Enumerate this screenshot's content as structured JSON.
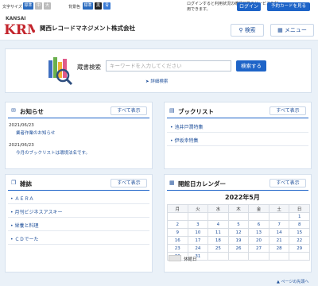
{
  "options": {
    "font_size_label": "文字サイズ",
    "font_sizes": [
      "標準",
      "中",
      "大"
    ],
    "bg_color_label": "背景色",
    "bg_colors": [
      "標準",
      "黒",
      "青"
    ]
  },
  "header": {
    "login_note": "ログインすると利用状況の確認日等のサービスを利用できます。",
    "login_label": "ログイン",
    "card_label": "予約カードを見る",
    "logo_top": "KANSAI",
    "logo_main": "KRM",
    "company": "関西レコードマネジメント株式会社",
    "search_label": "検索",
    "menu_label": "メニュー"
  },
  "search": {
    "label": "蔵書検索",
    "placeholder": "キーワードを入力してください",
    "button": "検索する",
    "advanced": "詳細検索"
  },
  "news": {
    "title": "お知らせ",
    "show_all": "すべて表示",
    "items": [
      {
        "date": "2021/06/23",
        "text": "業者作業のお知らせ"
      },
      {
        "date": "2021/06/23",
        "text": "今月のブックリストは環境法名です。"
      }
    ]
  },
  "booklist": {
    "title": "ブックリスト",
    "show_all": "すべて表示",
    "items": [
      "池井戸潤特集",
      "伊坂幸特集"
    ]
  },
  "magazines": {
    "title": "雑誌",
    "show_all": "すべて表示",
    "items": [
      "ＡＥＲＡ",
      "月刊ビジネスアスキー",
      "栄養と料理",
      "ＣＤでーた"
    ]
  },
  "calendar": {
    "title": "開館日カレンダー",
    "show_all": "すべて表示",
    "month": "2022年5月",
    "weekdays": [
      "月",
      "火",
      "水",
      "木",
      "金",
      "土",
      "日"
    ],
    "weeks": [
      [
        "",
        "",
        "",
        "",
        "",
        "",
        "1"
      ],
      [
        "2",
        "3",
        "4",
        "5",
        "6",
        "7",
        "8"
      ],
      [
        "9",
        "10",
        "11",
        "12",
        "13",
        "14",
        "15"
      ],
      [
        "16",
        "17",
        "18",
        "19",
        "20",
        "21",
        "22"
      ],
      [
        "23",
        "24",
        "25",
        "26",
        "27",
        "28",
        "29"
      ],
      [
        "30",
        "31",
        "",
        "",
        "",
        "",
        ""
      ]
    ],
    "legend": "休館日"
  },
  "footer": {
    "page_top": "ページの先頭へ"
  },
  "colors": {
    "accent": "#1e64c8",
    "link": "#1e4f9a",
    "page_bg": "#eaf1f8"
  }
}
